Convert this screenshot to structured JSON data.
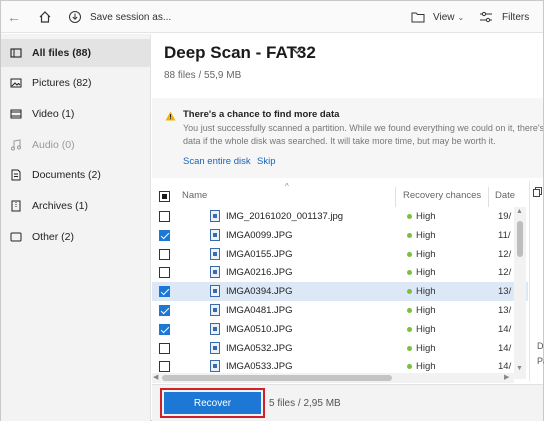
{
  "toolbar": {
    "back_icon": "arrow-left-icon",
    "home_icon": "home-icon",
    "save_label": "Save session as...",
    "view_label": "View",
    "filters_label": "Filters"
  },
  "sidebar": {
    "items": [
      {
        "label": "All files (88)",
        "icon": "all-files-icon",
        "active": true
      },
      {
        "label": "Pictures (82)",
        "icon": "picture-icon",
        "active": false
      },
      {
        "label": "Video (1)",
        "icon": "video-icon",
        "active": false
      },
      {
        "label": "Audio (0)",
        "icon": "music-icon",
        "active": false
      },
      {
        "label": "Documents (2)",
        "icon": "document-icon",
        "active": false
      },
      {
        "label": "Archives (1)",
        "icon": "archive-icon",
        "active": false
      },
      {
        "label": "Other (2)",
        "icon": "other-icon",
        "active": false
      }
    ]
  },
  "main": {
    "title": "Deep Scan - FAT32",
    "subtitle": "88 files / 55,9 MB",
    "notice": {
      "title": "There's a chance to find more data",
      "body_line1": "You just successfully scanned a partition. While we found everything we could on it, there's",
      "body_line2": "data if the whole disk was searched. It will take more time, but may be worth it.",
      "link_scan": "Scan entire disk",
      "link_skip": "Skip"
    },
    "columns": {
      "name": "Name",
      "chances": "Recovery chances",
      "date": "Date"
    },
    "rows": [
      {
        "name": "IMG_20161020_001137.jpg",
        "chance": "High",
        "date": "19/",
        "checked": false
      },
      {
        "name": "IMGA0099.JPG",
        "chance": "High",
        "date": "11/",
        "checked": true
      },
      {
        "name": "IMGA0155.JPG",
        "chance": "High",
        "date": "12/",
        "checked": false
      },
      {
        "name": "IMGA0216.JPG",
        "chance": "High",
        "date": "12/",
        "checked": false
      },
      {
        "name": "IMGA0394.JPG",
        "chance": "High",
        "date": "13/",
        "checked": true
      },
      {
        "name": "IMGA0481.JPG",
        "chance": "High",
        "date": "13/",
        "checked": true
      },
      {
        "name": "IMGA0510.JPG",
        "chance": "High",
        "date": "14/",
        "checked": true
      },
      {
        "name": "IMGA0532.JPG",
        "chance": "High",
        "date": "14/",
        "checked": false
      },
      {
        "name": "IMGA0533.JPG",
        "chance": "High",
        "date": "14/",
        "checked": false
      }
    ],
    "side_peek": {
      "d": "D",
      "pa": "Pa"
    }
  },
  "footer": {
    "recover_label": "Recover",
    "summary": "5 files / 2,95 MB"
  },
  "colors": {
    "accent": "#1c78d4",
    "highlight_border": "#d0202a",
    "status_high": "#7bbf3c",
    "warning": "#f0b400"
  }
}
